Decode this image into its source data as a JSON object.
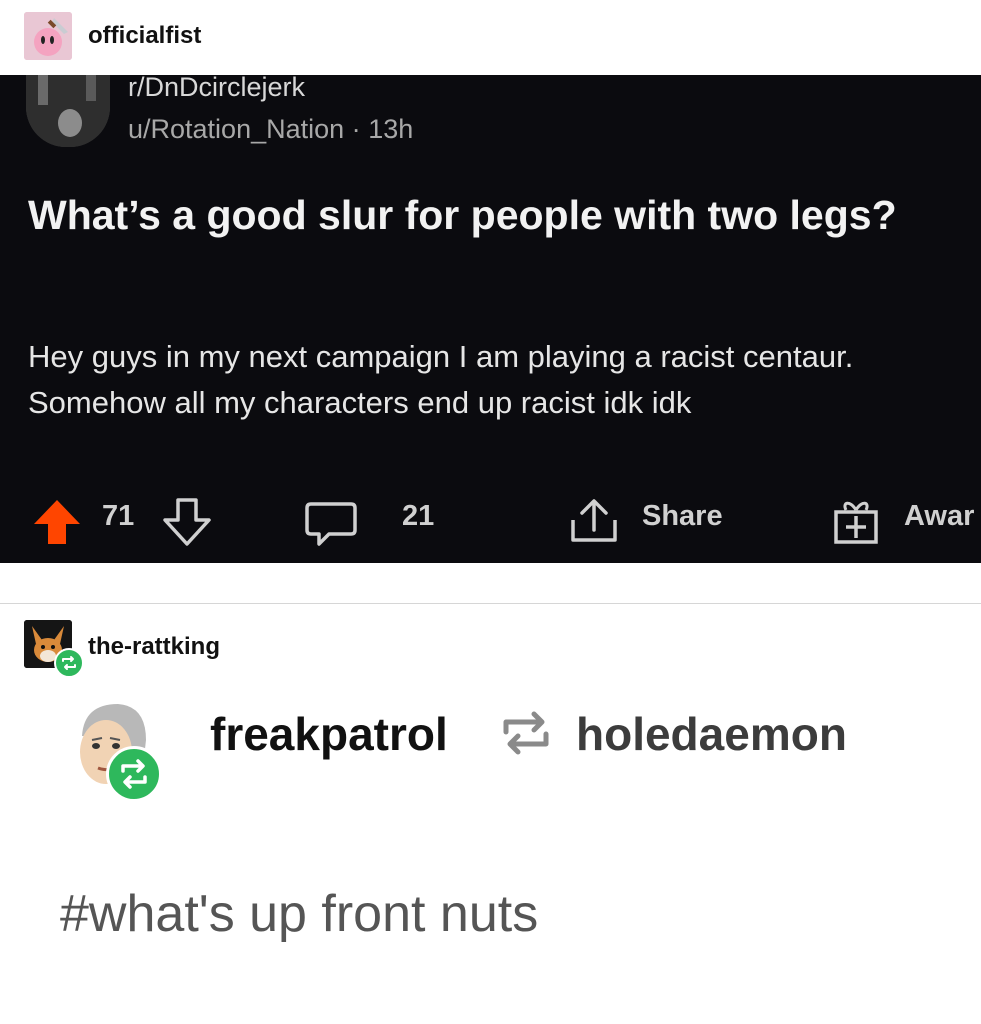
{
  "post1": {
    "username": "officialfist",
    "avatar_icon": "kirby-knife-avatar"
  },
  "reddit": {
    "subreddit": "r/DnDcirclejerk",
    "author": "u/Rotation_Nation",
    "separator": "·",
    "age": "13h",
    "title": "What’s a good slur for people with two legs?",
    "body": "Hey guys in my next campaign I am playing a racist centaur. Somehow all my characters end up racist idk idk",
    "upvotes": "71",
    "comments": "21",
    "share_label": "Share",
    "award_label": "Awar",
    "colors": {
      "background": "#0b0b0f",
      "upvote": "#ff4500",
      "text": "#f2f2f2"
    }
  },
  "post2": {
    "username": "the-rattking",
    "avatar_icon": "corgi-avatar",
    "reblog_chain": {
      "from": "freakpatrol",
      "to": "holedaemon"
    },
    "tag": "#what's up front nuts",
    "colors": {
      "reblog_badge": "#2eb85c"
    }
  }
}
